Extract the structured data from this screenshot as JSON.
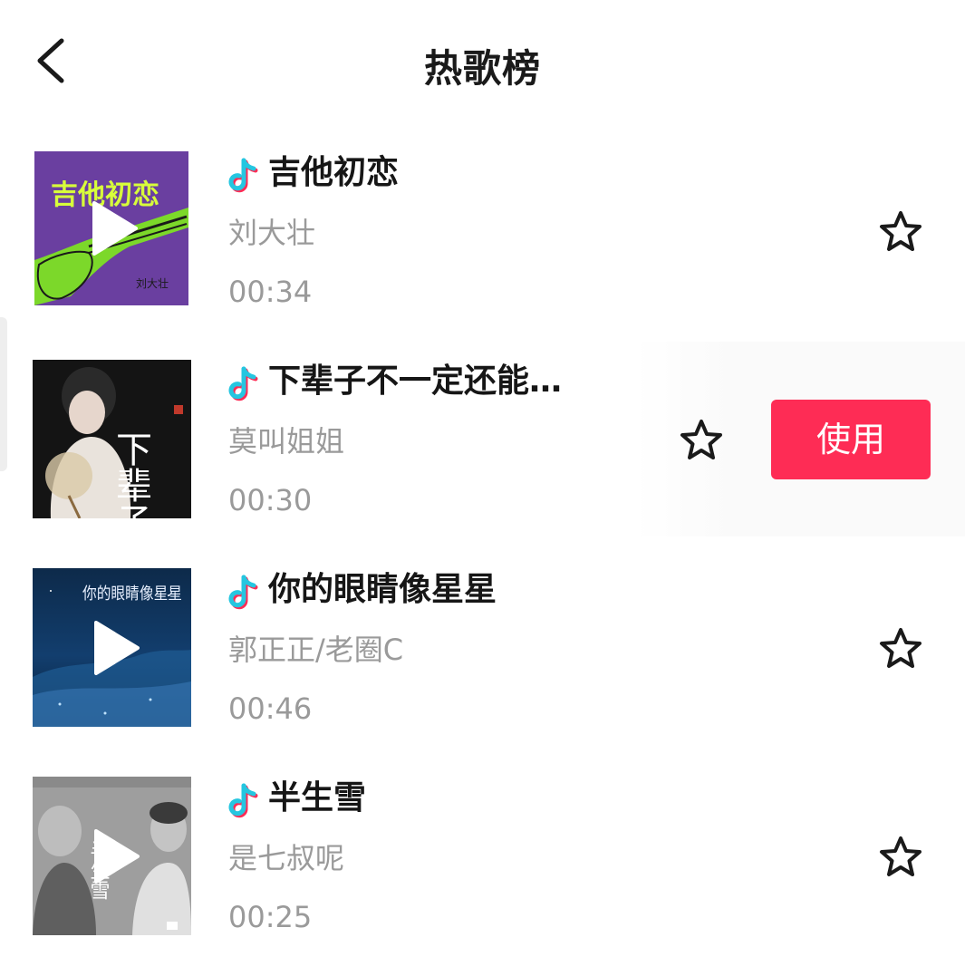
{
  "header": {
    "title": "热歌榜",
    "back_icon": "chevron-left-icon"
  },
  "colors": {
    "title_text": "#161616",
    "secondary_text": "#9a9a9a",
    "use_button": "#fe2c55",
    "note_cyan": "#25c6e0",
    "note_pink": "#fe2c55"
  },
  "songs": [
    {
      "title": "吉他初恋",
      "artist": "刘大壮",
      "duration": "00:34",
      "cover_text": "吉他初恋",
      "cover_signature": "刘大壮",
      "show_play": true,
      "selected": false
    },
    {
      "title": "下辈子不一定还能…",
      "artist": "莫叫姐姐",
      "duration": "00:30",
      "cover_text": "下辈子",
      "show_play": false,
      "selected": true,
      "use_label": "使用"
    },
    {
      "title": "你的眼睛像星星",
      "artist": "郭正正/老圈C",
      "duration": "00:46",
      "cover_text": "你的眼睛像星星",
      "show_play": true,
      "selected": false
    },
    {
      "title": "半生雪",
      "artist": "是七叔呢",
      "duration": "00:25",
      "cover_text": "半生雪",
      "show_play": true,
      "selected": false
    }
  ]
}
